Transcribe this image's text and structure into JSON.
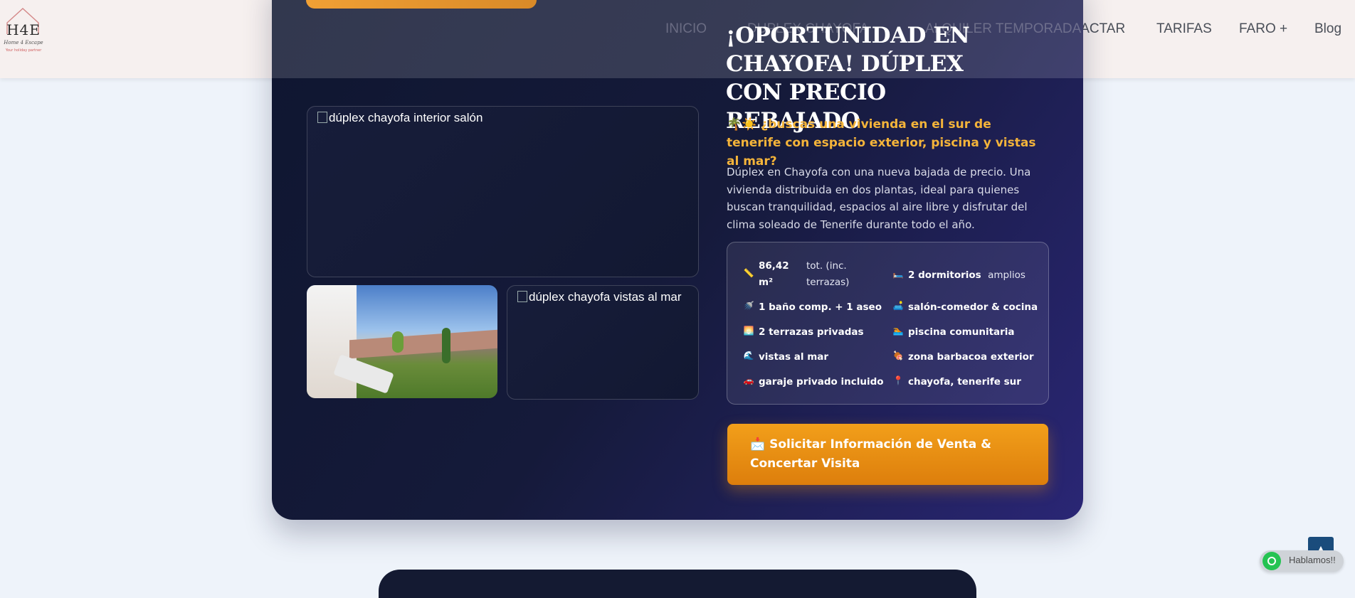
{
  "header": {
    "logo": {
      "word": "H4E",
      "tagline": "Home 4 Escape",
      "small": "Your holiday partner"
    },
    "nav": [
      "TACTAR",
      "TARIFAS",
      "FARO +",
      "Blog"
    ],
    "nav_behind": [
      "INICIO",
      "DUPLEX CHAYOFA",
      "...",
      "ALQUILER TEMPORADA"
    ]
  },
  "listing": {
    "title": "¡OPORTUNIDAD EN CHAYOFA! DÚPLEX CON PRECIO REBAJADO",
    "subhead": "🌴☀️ ¿buscas una vivienda en el sur de tenerife con espacio exterior, piscina y vistas al mar?",
    "description": "Dúplex en Chayofa con una nueva bajada de precio. Una vivienda distribuida en dos plantas, ideal para quienes buscan tranquilidad, espacios al aire libre y disfrutar del clima soleado de Tenerife durante todo el año.",
    "images": {
      "main_alt": "dúplex chayofa interior salón",
      "sea_alt": "dúplex chayofa vistas al mar"
    },
    "features": [
      {
        "icon": "📏",
        "icon_name": "ruler-icon",
        "bold": "86,42 m²",
        "extra": "tot. (inc. terrazas)"
      },
      {
        "icon": "🛏️",
        "icon_name": "bed-icon",
        "bold": "2 dormitorios",
        "extra": "amplios"
      },
      {
        "icon": "🚿",
        "icon_name": "shower-icon",
        "bold": "1 baño comp. + 1 aseo",
        "extra": ""
      },
      {
        "icon": "🛋️",
        "icon_name": "sofa-icon",
        "bold": "salón-comedor & cocina",
        "extra": ""
      },
      {
        "icon": "🌅",
        "icon_name": "sunrise-icon",
        "bold": "2 terrazas privadas",
        "extra": ""
      },
      {
        "icon": "🏊",
        "icon_name": "swimmer-icon",
        "bold": "piscina comunitaria",
        "extra": ""
      },
      {
        "icon": "🌊",
        "icon_name": "wave-icon",
        "bold": "vistas al mar",
        "extra": ""
      },
      {
        "icon": "🍖",
        "icon_name": "bbq-icon",
        "bold": "zona barbacoa exterior",
        "extra": ""
      },
      {
        "icon": "🚗",
        "icon_name": "car-icon",
        "bold": "garaje privado incluido",
        "extra": ""
      },
      {
        "icon": "📍",
        "icon_name": "pin-icon",
        "bold": "chayofa, tenerife sur",
        "extra": ""
      }
    ],
    "cta": "📩 Solicitar Información de Venta & Concertar Visita"
  },
  "widgets": {
    "whatsapp_label": "Hablamos!!",
    "scroll_top_icon": "chevron-up-icon"
  },
  "colors": {
    "accent": "#f4b43a",
    "cta": "#e8900f",
    "card_dark": "#151a3a"
  }
}
